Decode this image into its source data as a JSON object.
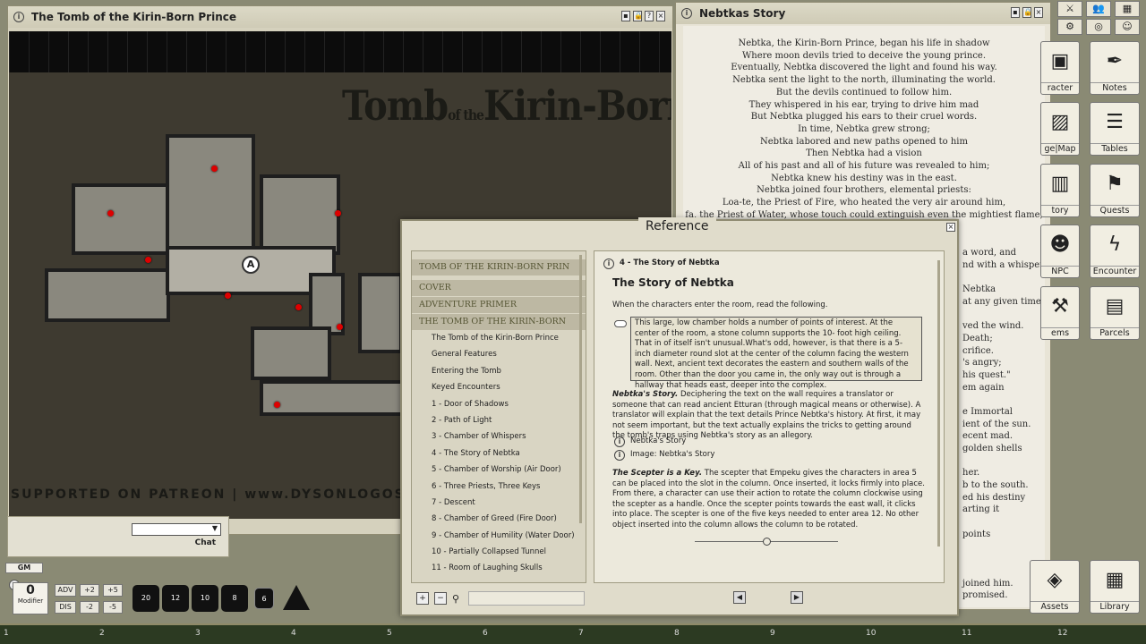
{
  "map_window": {
    "title": "The Tomb of the Kirin-Born Prince",
    "map_title_a": "Tomb",
    "map_title_of": "of the",
    "map_title_b": "Kirin-Born Prince",
    "footer_text": "SUPPORTED ON PATREON  |  www.DYSONLOGOS.c",
    "token_label": "A"
  },
  "chat": {
    "label": "Chat"
  },
  "story_window": {
    "title": "Nebtkas Story",
    "lines": [
      "Nebtka, the Kirin-Born Prince, began his life in shadow",
      "Where moon devils tried to deceive the young prince.",
      "Eventually, Nebtka discovered the light and found his way.",
      "Nebtka sent the light to the north, illuminating the world.",
      "But the devils continued to follow him.",
      "They whispered in his ear, trying to drive him mad",
      "But Nebtka plugged his ears to their cruel words.",
      "In time, Nebtka grew strong;",
      "Nebtka labored and new paths opened to him",
      "Then Nebtka had a vision",
      "All of his past and all of his future was revealed to him;",
      "Nebtka knew his destiny was in the east.",
      "Nebtka joined four brothers, elemental priests:",
      "Loa-te, the Priest of Fire, who heated the very air around him,",
      "fa, the Priest of Water, whose touch could extinguish even the mightiest flame,"
    ],
    "partial_lines": [
      "a word, and",
      "nd with a whisper",
      "",
      "Nebtka",
      "at any given time.\"",
      "",
      "ved the wind.",
      "Death;",
      "crifice.",
      "'s angry;",
      "his quest.\"",
      "em again",
      "",
      "e Immortal",
      "ient of the sun.",
      "ecent mad.",
      "golden shells",
      "",
      "her.",
      "b to the south.",
      "ed his destiny",
      "arting it",
      "",
      "points",
      "",
      "",
      "",
      "joined him.",
      "promised."
    ]
  },
  "reference": {
    "title": "Reference",
    "toc_sections": [
      "TOMB OF THE KIRIN-BORN PRIN",
      "COVER",
      "ADVENTURE PRIMER",
      "THE TOMB OF THE KIRIN-BORN"
    ],
    "toc_items": [
      "The Tomb of the Kirin-Born Prince",
      "General Features",
      "Entering the Tomb",
      "Keyed Encounters",
      "1 - Door of Shadows",
      "2 - Path of Light",
      "3 - Chamber of Whispers",
      "4 - The Story of Nebtka",
      "5 - Chamber of Worship (Air Door)",
      "6 - Three Priests, Three Keys",
      "7 - Descent",
      "8 - Chamber of Greed (Fire Door)",
      "9 - Chamber of Humility (Water Door)",
      "10 - Partially Collapsed Tunnel",
      "11 - Room of Laughing Skulls"
    ],
    "crumb": "4 - The Story of Nebtka",
    "heading": "The Story of Nebtka",
    "intro": "When the characters enter the room, read the following.",
    "read_aloud": "This large, low chamber holds a number of points of interest. At the center of the room, a stone column supports the 10- foot high ceiling. That in of itself isn't unusual.What's odd, however, is that there is a 5-inch diameter round slot at the center of the column facing the western wall. Next, ancient text decorates the eastern and southern walls of the room. Other than the door you came in, the only way out is through a hallway that heads east, deeper into the complex.",
    "p1_bold": "Nebtka's Story.",
    "p1": " Deciphering the text on the wall requires a translator or someone that can read ancient Etturan (through magical means or otherwise). A translator will explain that the text details Prince Nebtka's history. At first, it may not seem important, but the text actually explains the tricks to getting around the tomb's traps using Nebtka's story as an allegory.",
    "link1": "Nebtka's Story",
    "link2": "Image: Nebtka's Story",
    "p2_bold": "The Scepter is a Key.",
    "p2": " The scepter that Empeku gives the characters in area 5 can be placed into the slot in the column. Once inserted, it locks firmly into place. From there, a character can use their action to rotate the column clockwise using the scepter as a handle. Once the scepter points towards the east wall, it clicks into place. The scepter is one of the five keys needed to enter area 12. No other object inserted into the column allows the column to be rotated."
  },
  "sidebar": [
    {
      "label": "racter",
      "icon": "character-icon",
      "glyph": "▣"
    },
    {
      "label": "Notes",
      "icon": "quill-icon",
      "glyph": "✒"
    },
    {
      "label": "ge|Map",
      "icon": "image-icon",
      "glyph": "▨"
    },
    {
      "label": "Tables",
      "icon": "list-icon",
      "glyph": "☰"
    },
    {
      "label": "tory",
      "icon": "book-icon",
      "glyph": "▥"
    },
    {
      "label": "Quests",
      "icon": "flag-icon",
      "glyph": "⚑"
    },
    {
      "label": "NPC",
      "icon": "npc-icon",
      "glyph": "☻"
    },
    {
      "label": "Encounter",
      "icon": "lightning-icon",
      "glyph": "ϟ"
    },
    {
      "label": "ems",
      "icon": "items-icon",
      "glyph": "⚒"
    },
    {
      "label": "Parcels",
      "icon": "box-icon",
      "glyph": "▤"
    },
    {
      "label": "Assets",
      "icon": "layers-icon",
      "glyph": "◈"
    },
    {
      "label": "Library",
      "icon": "library-icon",
      "glyph": "▦"
    }
  ],
  "bottom": {
    "gm": "GM",
    "modifier_value": "0",
    "modifier_label": "Modifier",
    "adv": "ADV",
    "dis": "DIS",
    "p2": "+2",
    "p5": "+5",
    "m2": "-2",
    "m5": "-5",
    "dice": [
      "20",
      "12",
      "10",
      "8",
      "6",
      "4"
    ]
  },
  "ruler": [
    "1",
    "2",
    "3",
    "4",
    "5",
    "6",
    "7",
    "8",
    "9",
    "10",
    "11",
    "12"
  ]
}
